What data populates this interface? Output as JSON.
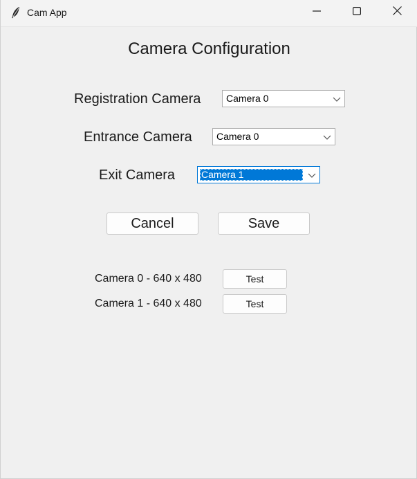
{
  "window": {
    "title": "Cam App",
    "app_icon": "feather-icon",
    "controls": [
      "minimize-icon",
      "maximize-icon",
      "close-icon"
    ]
  },
  "main": {
    "heading": "Camera Configuration",
    "settings": [
      {
        "label": "Registration Camera",
        "selected": "Camera 0",
        "focused": false
      },
      {
        "label": "Entrance Camera",
        "selected": "Camera 0",
        "focused": false
      },
      {
        "label": "Exit Camera",
        "selected": "Camera 1",
        "focused": true
      }
    ],
    "cancel_label": "Cancel",
    "save_label": "Save",
    "cameras": [
      {
        "info": "Camera 0 - 640 x 480",
        "test_label": "Test"
      },
      {
        "info": "Camera 1 - 640 x 480",
        "test_label": "Test"
      }
    ]
  },
  "colors": {
    "window_bg": "#f0f0f0",
    "focus_accent": "#0078d7"
  }
}
